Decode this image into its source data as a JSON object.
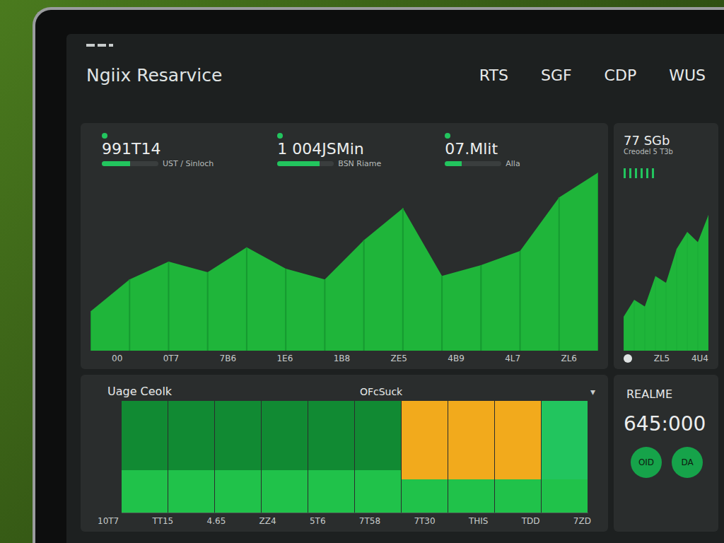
{
  "window": {
    "title": "Ngiix Resarvice"
  },
  "nav": [
    "RTS",
    "SGF",
    "CDP",
    "WUS"
  ],
  "stats": [
    {
      "value": "991T14",
      "label": "UST / Sinloch",
      "level": 0.5
    },
    {
      "value": "1 004JSMin",
      "label": "BSN Riame",
      "level": 0.75
    },
    {
      "value": "07.Mlit",
      "label": "Alla",
      "level": 0.3
    }
  ],
  "traffic_chart": {
    "series": [
      22,
      40,
      50,
      44,
      58,
      46,
      40,
      62,
      80,
      42,
      48,
      56,
      86,
      100
    ],
    "x_ticks": [
      "00",
      "0T7",
      "7B6",
      "1E6",
      "1B8",
      "ZE5",
      "4B9",
      "4L7",
      "ZL6"
    ]
  },
  "side_chart": {
    "value": "77 SGb",
    "label": "Creodel 5 T3b",
    "meter_levels": [
      0.8,
      0.8,
      0.8,
      0.8,
      0.8,
      0.8
    ],
    "series": [
      20,
      30,
      26,
      44,
      40,
      60,
      70,
      64,
      80
    ],
    "x_ticks": [
      "ZL5",
      "4U4"
    ]
  },
  "usage": {
    "title": "Uage Ceolk",
    "subtitle": "OFcSuck",
    "menu": "▾",
    "bars": [
      {
        "values": [
          38,
          62
        ],
        "color": "#118a33"
      },
      {
        "values": [
          38,
          62
        ],
        "color": "#118a33"
      },
      {
        "values": [
          38,
          62
        ],
        "color": "#118a33"
      },
      {
        "values": [
          38,
          62
        ],
        "color": "#118a33"
      },
      {
        "values": [
          38,
          62
        ],
        "color": "#118a33"
      },
      {
        "values": [
          38,
          62
        ],
        "color": "#118a33"
      },
      {
        "values": [
          30,
          70
        ],
        "color": "#f2aa1c"
      },
      {
        "values": [
          30,
          70
        ],
        "color": "#f2aa1c"
      },
      {
        "values": [
          30,
          70
        ],
        "color": "#f2aa1c"
      },
      {
        "values": [
          30,
          70
        ],
        "color": "#22c55e"
      }
    ],
    "x_ticks": [
      "10T7",
      "TT15",
      "4.65",
      "ZZ4",
      "5T6",
      "7T58",
      "7T30",
      "THIS",
      "TDD",
      "7ZD"
    ]
  },
  "realtime": {
    "title": "REALME",
    "value": "645:000",
    "buttons": [
      "OID",
      "DA"
    ]
  }
}
